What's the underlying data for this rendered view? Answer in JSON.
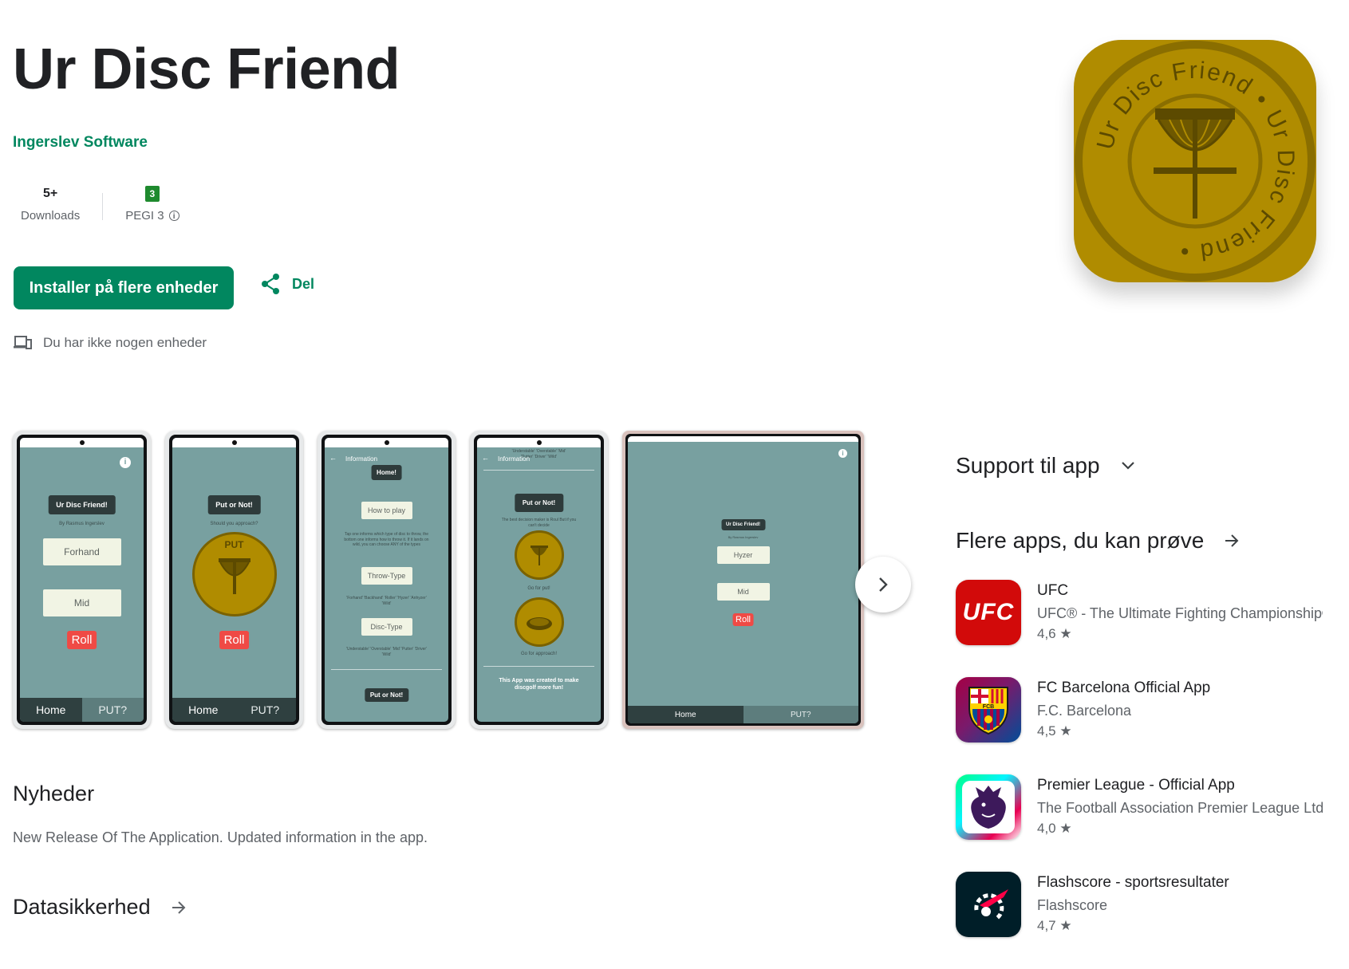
{
  "app": {
    "title": "Ur Disc Friend",
    "developer": "Ingerslev Software",
    "downloads_value": "5+",
    "downloads_label": "Downloads",
    "pegi_rating": "3",
    "pegi_label": "PEGI 3",
    "install_label": "Installer på flere enheder",
    "share_label": "Del",
    "devices_note": "Du har ikke nogen enheder",
    "icon_ring_text": "Ur Disc Friend • Ur Disc Friend •"
  },
  "screenshots": {
    "s1": {
      "header": "Ur Disc Friend!",
      "sub": "By Rasmus Ingerslev",
      "btn1": "Forhand",
      "btn2": "Mid",
      "roll": "Roll",
      "tab1": "Home",
      "tab2": "PUT?"
    },
    "s2": {
      "header": "Put or Not!",
      "sub": "Should you approach?",
      "coin": "PUT",
      "roll": "Roll",
      "tab1": "Home",
      "tab2": "PUT?"
    },
    "s3": {
      "nav": "Information",
      "home": "Home!",
      "btn1": "How to play",
      "info1": "Tap one informs which type of disc to throw, the bottom one informs how to throw it. If it lands on wild, you can choose ANY of the types",
      "btn2": "Throw-Type",
      "info2": "'Forhand' 'Backhand' 'Roller' 'Hyzer' 'Anhyzer' 'Wild'",
      "btn3": "Disc-Type",
      "info3": "'Understable' 'Overstable' 'Mid' 'Putter' 'Driver' 'Wild'",
      "bottom": "Put or Not!"
    },
    "s4": {
      "nav": "Information",
      "top": "'Understable' 'Overstable' 'Mid' 'Putter' 'Driver' 'Wild'",
      "header": "Put or Not!",
      "sub": "The best decision maker is Roul But if you can't decide",
      "caption1": "Go for put!",
      "caption2": "Go for approach!",
      "footer": "This App was created to make discgolf more fun!"
    },
    "s5": {
      "header": "Ur Disc Friend!",
      "sub": "By Rasmus Ingerslev",
      "btn1": "Hyzer",
      "btn2": "Mid",
      "roll": "Roll",
      "tab1": "Home",
      "tab2": "PUT?"
    }
  },
  "news": {
    "title": "Nyheder",
    "text": "New Release Of The Application. Updated information in the app."
  },
  "data_safety": {
    "title": "Datasikkerhed"
  },
  "support": {
    "title": "Support til app"
  },
  "more_apps": {
    "title": "Flere apps, du kan prøve",
    "items": [
      {
        "name": "UFC",
        "developer": "UFC® - The Ultimate Fighting Championship®",
        "rating": "4,6 ★",
        "icon": "ufc-logo-icon",
        "icon_text": "UFC"
      },
      {
        "name": "FC Barcelona Official App",
        "developer": "F.C. Barcelona",
        "rating": "4,5 ★",
        "icon": "fcb-crest-icon",
        "icon_text": "FCB"
      },
      {
        "name": "Premier League - Official App",
        "developer": "The Football Association Premier League Ltd",
        "rating": "4,0 ★",
        "icon": "premier-league-lion-icon"
      },
      {
        "name": "Flashscore - sportsresultater",
        "developer": "Flashscore",
        "rating": "4,7 ★",
        "icon": "flashscore-logo-icon"
      }
    ]
  },
  "colors": {
    "accent": "#01875f",
    "app_icon": "#b08c00",
    "screen_bg": "#78a0a0",
    "roll": "#ef4a45"
  }
}
